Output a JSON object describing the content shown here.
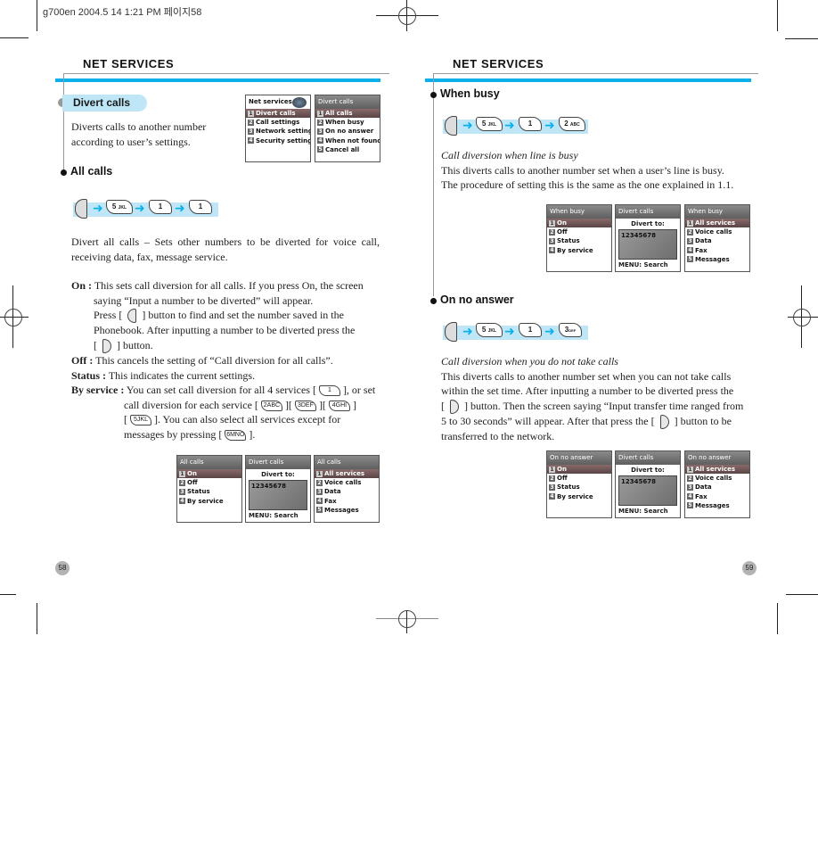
{
  "print_header": "g700en  2004.5 14 1:21 PM 페이지58",
  "left_page": {
    "section_title": "NET SERVICES",
    "divert_calls": {
      "label": "Divert calls",
      "description_line1": "Diverts calls to another number",
      "description_line2": "according to user’s settings."
    },
    "menu_screens": [
      {
        "title": "Net services",
        "items": [
          "Divert calls",
          "Call settings",
          "Network settings",
          "Security settings"
        ],
        "selected": 0
      },
      {
        "title": "Divert calls",
        "items": [
          "All calls",
          "When busy",
          "On no answer",
          "When not found",
          "Cancel all"
        ],
        "selected": 0
      }
    ],
    "all_calls": {
      "heading": "All calls",
      "key_sequence": [
        "MENU",
        "5",
        "1",
        "1"
      ],
      "key_sub": [
        "",
        "JKL",
        "",
        ""
      ],
      "description_line1": "Divert all calls – Sets other numbers to be diverted for voice call,",
      "description_line2": "receiving data, fax, message service.",
      "on_label": "On :",
      "on_line1": "This sets call diversion for all calls. If you press On, the screen",
      "on_line2": "saying “Input a number to be diverted” will appear.",
      "on_line3a": "Press [",
      "on_line3b": "] button to find and set the number saved in the",
      "on_line4": "Phonebook. After inputting a number to be diverted press the",
      "on_line5a": "[",
      "on_line5b": "] button.",
      "off_label": "Off :",
      "off_text": "This cancels the setting of “Call diversion for all calls”.",
      "status_label": "Status :",
      "status_text": "This indicates the current settings.",
      "byservice_label": "By service :",
      "bs_line1a": "You can set call diversion for all 4 services [",
      "bs_line1b": "], or set",
      "bs_line2a": "call diversion for each service [",
      "bs_line2b": "][",
      "bs_line2c": "][",
      "bs_line2d": "]",
      "bs_line3a": "[",
      "bs_line3b": "]. You can also select all services except for",
      "bs_line4a": "messages by pressing [",
      "bs_line4b": "].",
      "inline_keys": [
        "1",
        "2ABC",
        "3DEF",
        "4GHI",
        "5JKL",
        "6MNO"
      ]
    },
    "screens": [
      {
        "title": "All calls",
        "items": [
          "On",
          "Off",
          "Status",
          "By service"
        ],
        "selected": 0
      },
      {
        "title": "Divert calls",
        "prompt": "Divert to:",
        "number": "12345678",
        "footer": "MENU: Search"
      },
      {
        "title": "All calls",
        "items": [
          "All services",
          "Voice calls",
          "Data",
          "Fax",
          "Messages"
        ],
        "selected": 0
      }
    ],
    "page_number": "58"
  },
  "right_page": {
    "section_title": "NET SERVICES",
    "when_busy": {
      "heading": "When busy",
      "key_sequence": [
        "MENU",
        "5",
        "1",
        "2"
      ],
      "key_sub": [
        "",
        "JKL",
        "",
        "ABC"
      ],
      "subtitle": "Call diversion when line is busy",
      "line1": "This diverts calls to another number set when a user’s line is busy.",
      "line2": "The procedure of setting this is the same as the one explained in 1.1.",
      "screens": [
        {
          "title": "When busy",
          "items": [
            "On",
            "Off",
            "Status",
            "By service"
          ],
          "selected": 0
        },
        {
          "title": "Divert calls",
          "prompt": "Divert to:",
          "number": "12345678",
          "footer": "MENU: Search"
        },
        {
          "title": "When busy",
          "items": [
            "All services",
            "Voice calls",
            "Data",
            "Fax",
            "Messages"
          ],
          "selected": 0
        }
      ]
    },
    "on_no_answer": {
      "heading": "On no answer",
      "key_sequence": [
        "MENU",
        "5",
        "1",
        "3"
      ],
      "key_sub": [
        "",
        "JKL",
        "",
        "DEF"
      ],
      "subtitle": "Call diversion when you do not take calls",
      "line1": "This diverts calls to another number set when you can not take calls",
      "line2": "within the set time. After inputting a number to be diverted press the",
      "line3a": "[",
      "line3b": "] button. Then the screen saying “Input transfer time ranged from",
      "line4a": "5 to 30 seconds” will appear. After that press the [",
      "line4b": "] button to be",
      "line5": "transferred to the network.",
      "screens": [
        {
          "title": "On no answer",
          "items": [
            "On",
            "Off",
            "Status",
            "By service"
          ],
          "selected": 0
        },
        {
          "title": "Divert calls",
          "prompt": "Divert to:",
          "number": "12345678",
          "footer": "MENU: Search"
        },
        {
          "title": "On no answer",
          "items": [
            "All services",
            "Voice calls",
            "Data",
            "Fax",
            "Messages"
          ],
          "selected": 0
        }
      ]
    },
    "page_number": "59"
  },
  "colors": {
    "accent_blue": "#0ab0ea",
    "highlight_bg": "#bfe6f7",
    "rule_grey": "#999999"
  }
}
